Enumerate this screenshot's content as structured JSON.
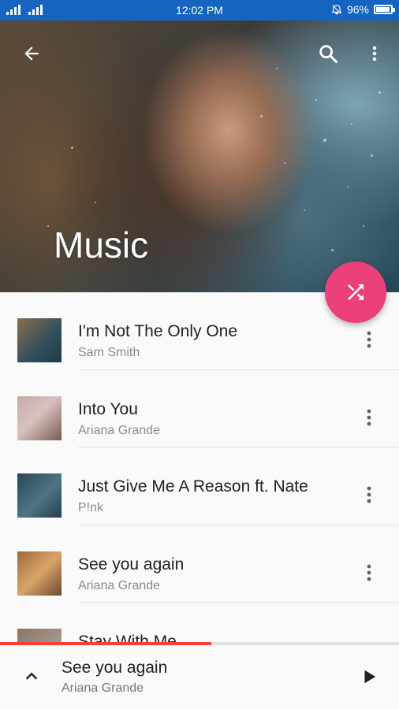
{
  "status_bar": {
    "time": "12:02 PM",
    "battery": "96%",
    "battery_level": 0.96,
    "icons": [
      "signal-icon",
      "signal-icon",
      "alarm-icon",
      "battery-icon"
    ]
  },
  "header": {
    "title": "Music",
    "icons": [
      "back-arrow-icon",
      "search-icon",
      "more-vert-icon"
    ]
  },
  "fab": {
    "icon": "shuffle-icon",
    "color": "#ec407a"
  },
  "songs": [
    {
      "title": "I'm Not The Only One",
      "artist": "Sam Smith"
    },
    {
      "title": "Into You",
      "artist": "Ariana Grande"
    },
    {
      "title": "Just Give Me A Reason ft. Nate",
      "artist": "P!nk"
    },
    {
      "title": "See you again",
      "artist": "Ariana Grande"
    },
    {
      "title": "Stay With Me",
      "artist": ""
    }
  ],
  "now_playing": {
    "title": "See you again",
    "artist": "Ariana Grande",
    "progress": 0.53,
    "icons": [
      "chevron-up-icon",
      "play-icon"
    ]
  },
  "colors": {
    "status_bar": "#1565c0",
    "accent": "#ec407a",
    "progress": "#f44336"
  }
}
